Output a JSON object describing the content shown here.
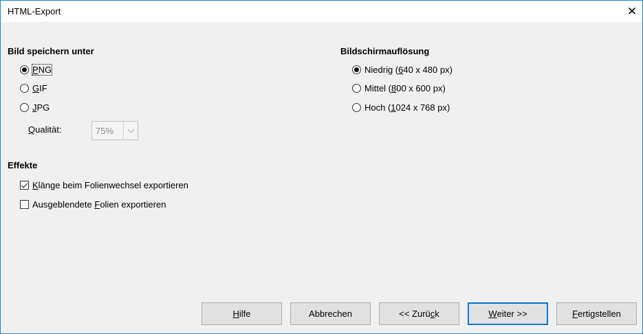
{
  "window": {
    "title": "HTML-Export"
  },
  "image_section": {
    "title": "Bild speichern unter",
    "options": [
      {
        "pre": "",
        "mnemonic": "P",
        "post": "NG",
        "checked": true
      },
      {
        "pre": "",
        "mnemonic": "G",
        "post": "IF",
        "checked": false
      },
      {
        "pre": "",
        "mnemonic": "J",
        "post": "PG",
        "checked": false
      }
    ],
    "quality": {
      "label_mnemonic": "Q",
      "label_rest": "ualität:",
      "value": "75%",
      "enabled": false
    }
  },
  "resolution_section": {
    "title": "Bildschirmauflösung",
    "options": [
      {
        "pre": "Niedrig (",
        "mnemonic": "6",
        "post": "40 x 480 px)",
        "checked": true
      },
      {
        "pre": "Mittel (",
        "mnemonic": "8",
        "post": "00 x 600 px)",
        "checked": false
      },
      {
        "pre": "Hoch (",
        "mnemonic": "1",
        "post": "024 x 768 px)",
        "checked": false
      }
    ]
  },
  "effects_section": {
    "title": "Effekte",
    "checkboxes": [
      {
        "pre": "",
        "mnemonic": "K",
        "post": "länge beim Folienwechsel exportieren",
        "checked": true
      },
      {
        "pre": "Ausgeblendete ",
        "mnemonic": "F",
        "post": "olien exportieren",
        "checked": false
      }
    ]
  },
  "buttons": {
    "help": {
      "pre": "",
      "mnemonic": "H",
      "post": "ilfe"
    },
    "cancel": {
      "label": "Abbrechen"
    },
    "back": {
      "pre": "<< Zurü",
      "mnemonic": "c",
      "post": "k"
    },
    "next": {
      "pre": "",
      "mnemonic": "W",
      "post": "eiter >>",
      "default": true
    },
    "finish": {
      "pre": "",
      "mnemonic": "F",
      "post": "ertigstellen"
    }
  }
}
